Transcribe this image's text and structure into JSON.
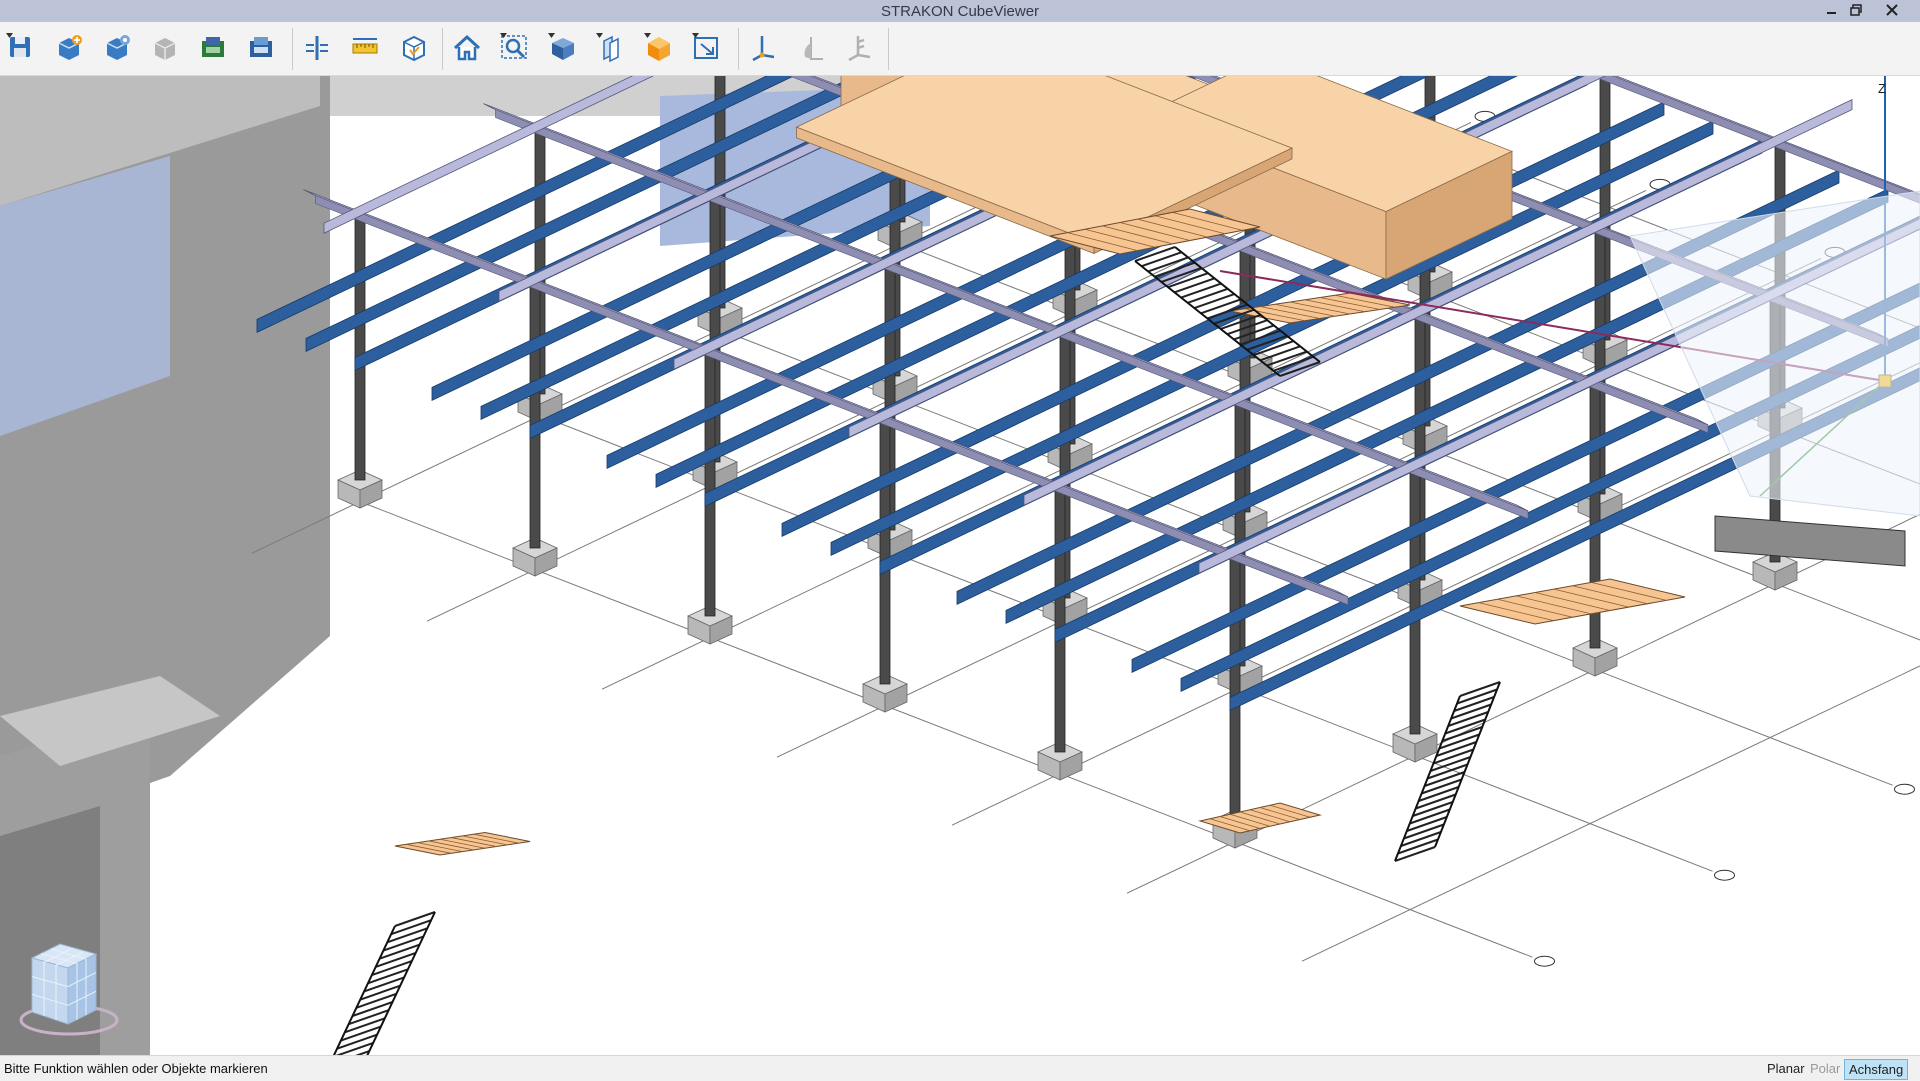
{
  "window": {
    "title": "STRAKON CubeViewer"
  },
  "toolbar": {
    "buttons": [
      {
        "name": "save",
        "icon": "save-icon",
        "has_dropdown": true
      },
      {
        "name": "add-model",
        "icon": "add-model-icon",
        "has_dropdown": false
      },
      {
        "name": "model-settings",
        "icon": "gear-model-icon",
        "has_dropdown": false
      },
      {
        "name": "model-grey",
        "icon": "grey-model-icon",
        "has_dropdown": false
      },
      {
        "name": "import",
        "icon": "import-icon",
        "has_dropdown": false
      },
      {
        "name": "export",
        "icon": "export-icon",
        "has_dropdown": false
      },
      {
        "name": "section",
        "icon": "section-icon",
        "has_dropdown": false
      },
      {
        "name": "measure",
        "icon": "ruler-icon",
        "has_dropdown": false
      },
      {
        "name": "clip-box",
        "icon": "clip-box-icon",
        "has_dropdown": false
      },
      {
        "name": "home",
        "icon": "home-icon",
        "has_dropdown": false
      },
      {
        "name": "zoom",
        "icon": "zoom-icon",
        "has_dropdown": true
      },
      {
        "name": "view-cube",
        "icon": "view-cube-icon",
        "has_dropdown": true
      },
      {
        "name": "cut-planes",
        "icon": "cut-planes-icon",
        "has_dropdown": true
      },
      {
        "name": "render-solid",
        "icon": "orange-cube-icon",
        "has_dropdown": true
      },
      {
        "name": "select-box",
        "icon": "select-box-icon",
        "has_dropdown": true
      },
      {
        "name": "axis-tool",
        "icon": "axis-tool-icon",
        "has_dropdown": false
      },
      {
        "name": "angle-tool",
        "icon": "angle-icon",
        "has_dropdown": false
      },
      {
        "name": "axis-disabled",
        "icon": "axis-grey-icon",
        "has_dropdown": false
      }
    ]
  },
  "viewport": {
    "axis_label": "Z"
  },
  "status": {
    "text": "Bitte Funktion wählen oder Objekte markieren",
    "modes": [
      {
        "label": "Planar",
        "state": "normal"
      },
      {
        "label": "Polar",
        "state": "disabled"
      },
      {
        "label": "Achsfang",
        "state": "active"
      }
    ]
  },
  "colors": {
    "beam_blue": "#2d5f9e",
    "beam_lilac": "#c9c9e6",
    "column_grey": "#4a4a4a",
    "wall_grey": "#8c8c8c",
    "footing_grey": "#bdbdbd",
    "wood": "#f7c592",
    "grid_line": "#7a7a7a",
    "axis_marker": "#8b2a5c"
  }
}
